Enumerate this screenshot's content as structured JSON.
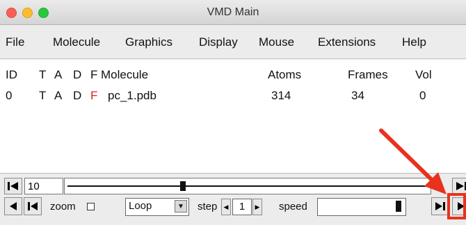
{
  "window": {
    "title": "VMD Main"
  },
  "menubar": {
    "items": [
      "File",
      "Molecule",
      "Graphics",
      "Display",
      "Mouse",
      "Extensions",
      "Help"
    ]
  },
  "molecule_list": {
    "headers": {
      "id": "ID",
      "t": "T",
      "a": "A",
      "d": "D",
      "f": "F",
      "molecule": "Molecule",
      "atoms": "Atoms",
      "frames": "Frames",
      "vol": "Vol"
    },
    "rows": [
      {
        "id": "0",
        "t": "T",
        "a": "A",
        "d": "D",
        "f": "F",
        "molecule": "pc_1.pdb",
        "atoms": "314",
        "frames": "34",
        "vol": "0"
      }
    ]
  },
  "animation": {
    "frame_value": "10",
    "zoom_label": "zoom",
    "loop_option": "Loop",
    "step_label": "step",
    "step_value": "1",
    "speed_label": "speed"
  },
  "annotation": {
    "color": "#e8321e"
  }
}
